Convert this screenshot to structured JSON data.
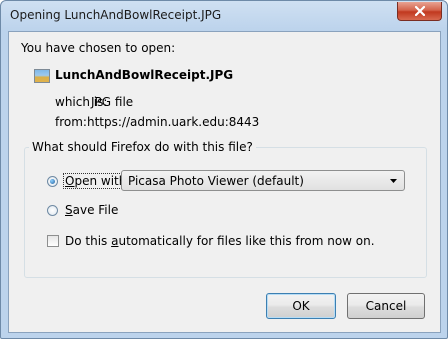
{
  "window": {
    "title": "Opening LunchAndBowlReceipt.JPG"
  },
  "intro": "You have chosen to open:",
  "file": {
    "icon": "image-file-icon",
    "name": "LunchAndBowlReceipt.JPG",
    "which_is_label": "which is:",
    "which_is_value": "JPG file",
    "from_label": "from:",
    "from_value": "https://admin.uark.edu:8443"
  },
  "action_group": {
    "legend": "What should Firefox do with this file?",
    "open_with": {
      "pre": "",
      "accel": "O",
      "post": "pen with",
      "checked": true
    },
    "app_select": {
      "selected": "Picasa Photo Viewer (default)"
    },
    "save_file": {
      "pre": "",
      "accel": "S",
      "post": "ave File",
      "checked": false
    },
    "auto": {
      "pre": "Do this ",
      "accel": "a",
      "post": "utomatically for files like this from now on.",
      "checked": false
    }
  },
  "buttons": {
    "ok": "OK",
    "cancel": "Cancel"
  }
}
